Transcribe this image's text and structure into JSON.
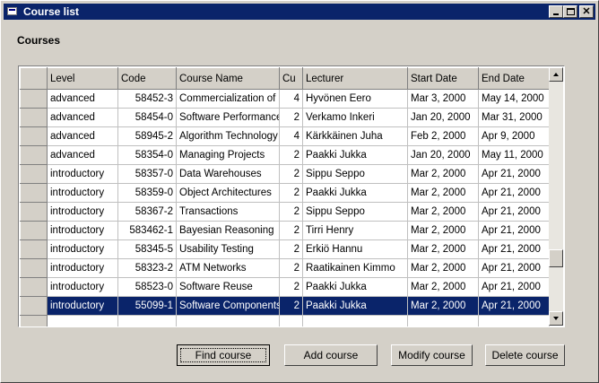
{
  "window": {
    "title": "Course list"
  },
  "section_label": "Courses",
  "table": {
    "columns": [
      "Level",
      "Code",
      "Course Name",
      "Cu",
      "Lecturer",
      "Start Date",
      "End Date"
    ],
    "rows": [
      [
        "advanced",
        "58452-3",
        "Commercialization of Sc",
        "4",
        "Hyvönen Eero",
        "Mar 3, 2000",
        "May 14, 2000"
      ],
      [
        "advanced",
        "58454-0",
        "Software Performance",
        "2",
        "Verkamo Inkeri",
        "Jan 20, 2000",
        "Mar 31, 2000"
      ],
      [
        "advanced",
        "58945-2",
        "Algorithm Technology",
        "4",
        "Kärkkäinen Juha",
        "Feb 2, 2000",
        "Apr 9, 2000"
      ],
      [
        "advanced",
        "58354-0",
        "Managing Projects",
        "2",
        "Paakki Jukka",
        "Jan 20, 2000",
        "May 11, 2000"
      ],
      [
        "introductory",
        "58357-0",
        "Data Warehouses",
        "2",
        "Sippu Seppo",
        "Mar 2, 2000",
        "Apr 21, 2000"
      ],
      [
        "introductory",
        "58359-0",
        "Object Architectures",
        "2",
        "Paakki Jukka",
        "Mar 2, 2000",
        "Apr 21, 2000"
      ],
      [
        "introductory",
        "58367-2",
        "Transactions",
        "2",
        "Sippu Seppo",
        "Mar 2, 2000",
        "Apr 21, 2000"
      ],
      [
        "introductory",
        "583462-1",
        "Bayesian Reasoning",
        "2",
        "Tirri Henry",
        "Mar 2, 2000",
        "Apr 21, 2000"
      ],
      [
        "introductory",
        "58345-5",
        "Usability Testing",
        "2",
        "Erkiö Hannu",
        "Mar 2, 2000",
        "Apr 21, 2000"
      ],
      [
        "introductory",
        "58323-2",
        "ATM Networks",
        "2",
        "Raatikainen Kimmo",
        "Mar 2, 2000",
        "Apr 21, 2000"
      ],
      [
        "introductory",
        "58523-0",
        "Software Reuse",
        "2",
        "Paakki Jukka",
        "Mar 2, 2000",
        "Apr 21, 2000"
      ],
      [
        "introductory",
        "55099-1",
        "Software Components",
        "2",
        "Paakki Jukka",
        "Mar 2, 2000",
        "Apr 21, 2000"
      ]
    ],
    "selected_row": 11
  },
  "buttons": {
    "find": "Find course",
    "add": "Add course",
    "modify": "Modify course",
    "delete": "Delete course"
  },
  "colors": {
    "title_bar": "#0a246a",
    "selection": "#0a246a",
    "face": "#d4d0c8"
  }
}
